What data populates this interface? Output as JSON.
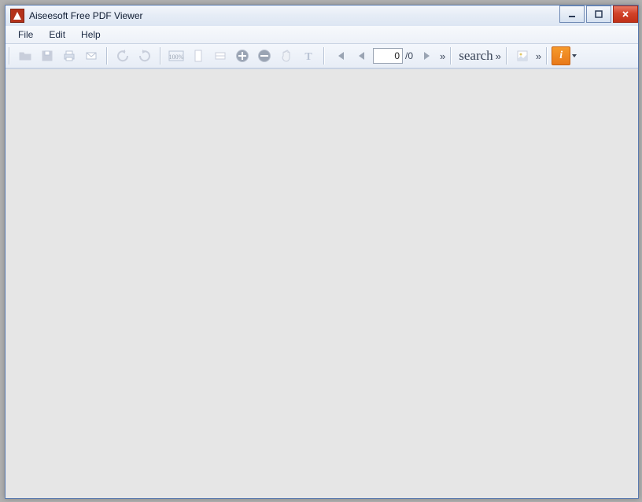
{
  "window": {
    "title": "Aiseesoft Free PDF Viewer"
  },
  "menu": {
    "file": "File",
    "edit": "Edit",
    "help": "Help"
  },
  "toolbar": {
    "page_current": "0",
    "page_total": "/0",
    "overflow": "»",
    "search_label": "search",
    "about_label": "i"
  }
}
